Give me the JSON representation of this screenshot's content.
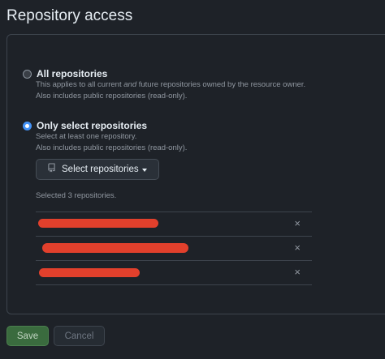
{
  "page": {
    "title": "Repository access"
  },
  "options": {
    "all": {
      "label": "All repositories",
      "desc_line1_pre": "This applies to all current ",
      "desc_line1_em": "and",
      "desc_line1_post": " future repositories owned by the resource owner.",
      "desc_line2": "Also includes public repositories (read-only).",
      "selected": false
    },
    "select": {
      "label": "Only select repositories",
      "desc_line1": "Select at least one repository.",
      "desc_line2": "Also includes public repositories (read-only).",
      "selected": true
    }
  },
  "select_button": {
    "label": "Select repositories",
    "icon": "repo-icon"
  },
  "selected_summary": "Selected 3 repositories.",
  "repositories": [
    {
      "name_redacted": true,
      "remove_label": "×"
    },
    {
      "name_redacted": true,
      "remove_label": "×"
    },
    {
      "name_redacted": true,
      "remove_label": "×"
    }
  ],
  "actions": {
    "save_label": "Save",
    "cancel_label": "Cancel"
  },
  "colors": {
    "accent": "#4493f8",
    "save_bg": "#3a6b3e",
    "redaction": "#e2402c"
  }
}
